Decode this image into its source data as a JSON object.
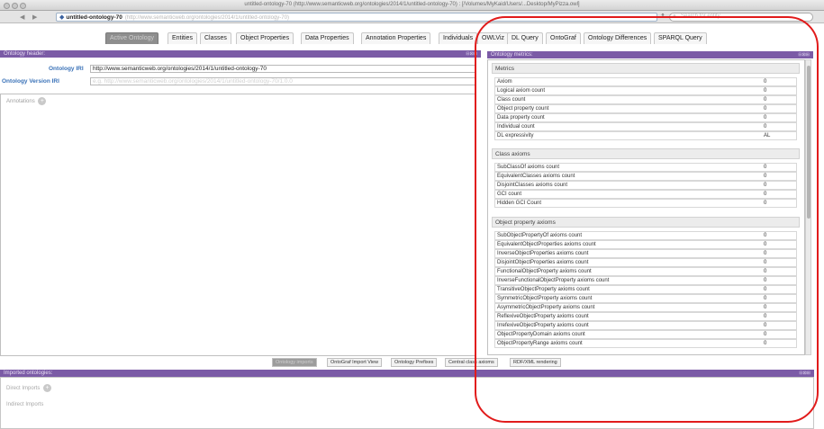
{
  "window": {
    "title": "untitled-ontology-70 (http://www.semanticweb.org/ontologies/2014/1/untitled-ontology-70) : [/Volumes/MyKaid/Users/...Desktop/MyPizza.owl]"
  },
  "address": {
    "name": "untitled-ontology-70",
    "iri": "(http://www.semanticweb.org/ontologies/2014/1/untitled-ontology-70)",
    "search_placeholder": "Search for entity"
  },
  "tabs": [
    {
      "label": "Active Ontology",
      "active": true
    },
    {
      "label": "Entities"
    },
    {
      "label": "Classes"
    },
    {
      "label": "Object Properties"
    },
    {
      "label": "Data Properties"
    },
    {
      "label": "Annotation Properties"
    },
    {
      "label": "Individuals"
    },
    {
      "label": "OWLViz"
    },
    {
      "label": "DL Query"
    },
    {
      "label": "OntoGraf"
    },
    {
      "label": "Ontology Differences"
    },
    {
      "label": "SPARQL Query"
    }
  ],
  "header_panel": {
    "title": "Ontology header:",
    "iri_label": "Ontology IRI",
    "iri_value": "http://www.semanticweb.org/ontologies/2014/1/untitled-ontology-70",
    "version_label": "Ontology Version IRI",
    "version_placeholder": "e.g. http://www.semanticweb.org/ontologies/2014/1/untitled-ontology-70/1.0.0",
    "annotations_label": "Annotations"
  },
  "metrics_panel": {
    "title": "Ontology metrics:",
    "sections": [
      {
        "title": "Metrics",
        "rows": [
          {
            "k": "Axiom",
            "v": "0"
          },
          {
            "k": "Logical axiom count",
            "v": "0"
          },
          {
            "k": "Class count",
            "v": "0"
          },
          {
            "k": "Object property count",
            "v": "0"
          },
          {
            "k": "Data property count",
            "v": "0"
          },
          {
            "k": "Individual count",
            "v": "0"
          },
          {
            "k": "DL expressivity",
            "v": "AL"
          }
        ]
      },
      {
        "title": "Class axioms",
        "rows": [
          {
            "k": "SubClassOf axioms count",
            "v": "0"
          },
          {
            "k": "EquivalentClasses axioms count",
            "v": "0"
          },
          {
            "k": "DisjointClasses axioms count",
            "v": "0"
          },
          {
            "k": "GCI count",
            "v": "0"
          },
          {
            "k": "Hidden GCI Count",
            "v": "0"
          }
        ]
      },
      {
        "title": "Object property axioms",
        "rows": [
          {
            "k": "SubObjectPropertyOf axioms count",
            "v": "0"
          },
          {
            "k": "EquivalentObjectProperties axioms count",
            "v": "0"
          },
          {
            "k": "InverseObjectProperties axioms count",
            "v": "0"
          },
          {
            "k": "DisjointObjectProperties axioms count",
            "v": "0"
          },
          {
            "k": "FunctionalObjectProperty axioms count",
            "v": "0"
          },
          {
            "k": "InverseFunctionalObjectProperty axioms count",
            "v": "0"
          },
          {
            "k": "TransitiveObjectProperty axioms count",
            "v": "0"
          },
          {
            "k": "SymmetricObjectProperty axioms count",
            "v": "0"
          },
          {
            "k": "AsymmetricObjectProperty axioms count",
            "v": "0"
          },
          {
            "k": "ReflexiveObjectProperty axioms count",
            "v": "0"
          },
          {
            "k": "IrrefexiveObjectProperty axioms count",
            "v": "0"
          },
          {
            "k": "ObjectPropertyDomain axioms count",
            "v": "0"
          },
          {
            "k": "ObjectPropertyRange axioms count",
            "v": "0"
          }
        ]
      }
    ]
  },
  "bottom_tabs": [
    {
      "label": "Ontology imports",
      "active": true
    },
    {
      "label": "OntoGraf Import View"
    },
    {
      "label": "Ontology Prefixes"
    },
    {
      "label": "Central class axioms"
    },
    {
      "label": "RDF/XML rendering"
    }
  ],
  "imports_panel": {
    "title": "Imported ontologies:",
    "direct_label": "Direct Imports",
    "indirect_label": "Indirect Imports"
  },
  "panel_buttons": "⊟⊠⊞",
  "accent_color": "#7b5ba6",
  "highlight_color": "#e11b1b"
}
